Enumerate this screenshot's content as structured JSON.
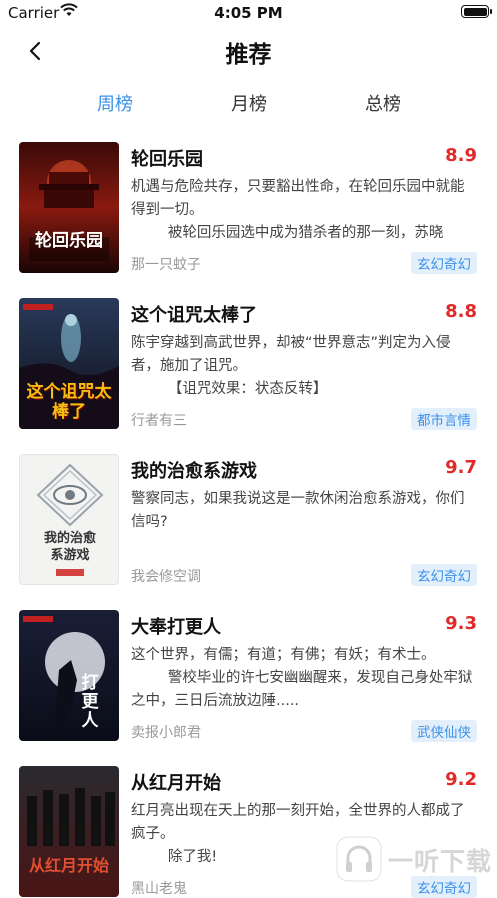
{
  "status_bar": {
    "carrier": "Carrier",
    "time": "4:05 PM"
  },
  "nav": {
    "title": "推荐"
  },
  "tabs": [
    {
      "label": "周榜",
      "active": true
    },
    {
      "label": "月榜",
      "active": false
    },
    {
      "label": "总榜",
      "active": false
    }
  ],
  "books": [
    {
      "title": "轮回乐园",
      "score": "8.9",
      "desc": "机遇与危险共存，只要豁出性命，在轮回乐园中就能得到一切。\n        被轮回乐园选中成为猎杀者的那一刻，苏晓",
      "author": "那一只蚊子",
      "tag": "玄幻奇幻",
      "cover_text": "轮回乐园"
    },
    {
      "title": "这个诅咒太棒了",
      "score": "8.8",
      "desc": "陈宇穿越到高武世界，却被“世界意志”判定为入侵者，施加了诅咒。\n        【诅咒效果：状态反转】",
      "author": "行者有三",
      "tag": "都市言情",
      "cover_text": "这个诅咒太棒了"
    },
    {
      "title": "我的治愈系游戏",
      "score": "9.7",
      "desc": "警察同志，如果我说这是一款休闲治愈系游戏，你们信吗?",
      "author": "我会修空调",
      "tag": "玄幻奇幻",
      "cover_text": "我的治愈系游戏"
    },
    {
      "title": "大奉打更人",
      "score": "9.3",
      "desc": "这个世界，有儒；有道；有佛；有妖；有术士。\n        警校毕业的许七安幽幽醒来，发现自己身处牢狱之中，三日后流放边陲.....",
      "author": "卖报小郎君",
      "tag": "武侠仙侠",
      "cover_text": "打更人"
    },
    {
      "title": "从红月开始",
      "score": "9.2",
      "desc": "红月亮出现在天上的那一刻开始，全世界的人都成了疯子。\n        除了我!",
      "author": "黑山老鬼",
      "tag": "玄幻奇幻",
      "cover_text": "从红月开始"
    }
  ],
  "watermark": {
    "text": "一听下载"
  },
  "colors": {
    "accent": "#3b8fe8",
    "score": "#e02a2a",
    "tag_bg": "#e3f0fc"
  }
}
